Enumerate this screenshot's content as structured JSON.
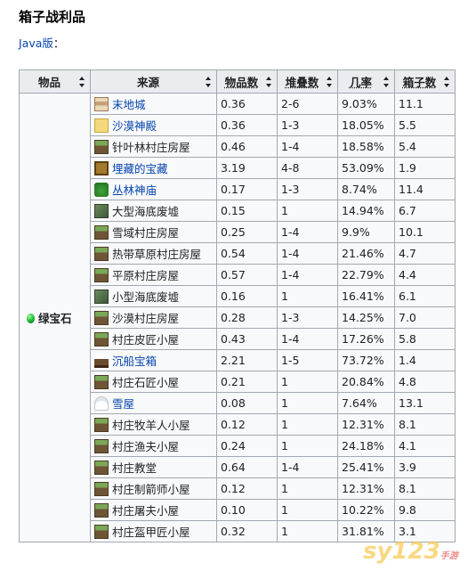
{
  "title": "箱子战利品",
  "edition": {
    "link": "Java版",
    "suffix": "："
  },
  "columns": [
    "物品",
    "来源",
    "物品数",
    "堆叠数",
    "几率",
    "箱子数"
  ],
  "item": {
    "name": "绿宝石",
    "icon": "emerald-icon"
  },
  "rows": [
    {
      "source": "末地城",
      "icon": "end-city-icon",
      "link": true,
      "count": "0.36",
      "stack": "2-6",
      "chance": "9.03%",
      "chests": "11.1"
    },
    {
      "source": "沙漠神殿",
      "icon": "desert-temple-icon",
      "link": true,
      "count": "0.36",
      "stack": "1-3",
      "chance": "18.05%",
      "chests": "5.5"
    },
    {
      "source": "针叶林村庄房屋",
      "icon": "village-house-icon",
      "link": false,
      "count": "0.46",
      "stack": "1-4",
      "chance": "18.58%",
      "chests": "5.4"
    },
    {
      "source": "埋藏的宝藏",
      "icon": "buried-treasure-icon",
      "link": true,
      "count": "3.19",
      "stack": "4-8",
      "chance": "53.09%",
      "chests": "1.9"
    },
    {
      "source": "丛林神庙",
      "icon": "jungle-temple-icon",
      "link": true,
      "count": "0.17",
      "stack": "1-3",
      "chance": "8.74%",
      "chests": "11.4"
    },
    {
      "source": "大型海底废墟",
      "icon": "ocean-ruin-icon",
      "link": false,
      "count": "0.15",
      "stack": "1",
      "chance": "14.94%",
      "chests": "6.7"
    },
    {
      "source": "雪域村庄房屋",
      "icon": "village-house-icon",
      "link": false,
      "count": "0.25",
      "stack": "1-4",
      "chance": "9.9%",
      "chests": "10.1"
    },
    {
      "source": "热带草原村庄房屋",
      "icon": "village-house-icon",
      "link": false,
      "count": "0.54",
      "stack": "1-4",
      "chance": "21.46%",
      "chests": "4.7"
    },
    {
      "source": "平原村庄房屋",
      "icon": "village-house-icon",
      "link": false,
      "count": "0.57",
      "stack": "1-4",
      "chance": "22.79%",
      "chests": "4.4"
    },
    {
      "source": "小型海底废墟",
      "icon": "ocean-ruin-icon",
      "link": false,
      "count": "0.16",
      "stack": "1",
      "chance": "16.41%",
      "chests": "6.1"
    },
    {
      "source": "沙漠村庄房屋",
      "icon": "village-house-icon",
      "link": false,
      "count": "0.28",
      "stack": "1-3",
      "chance": "14.25%",
      "chests": "7.0"
    },
    {
      "source": "村庄皮匠小屋",
      "icon": "village-house-icon",
      "link": false,
      "count": "0.43",
      "stack": "1-4",
      "chance": "17.26%",
      "chests": "5.8"
    },
    {
      "source": "沉船宝箱",
      "icon": "shipwreck-icon",
      "link": true,
      "count": "2.21",
      "stack": "1-5",
      "chance": "73.72%",
      "chests": "1.4"
    },
    {
      "source": "村庄石匠小屋",
      "icon": "village-house-icon",
      "link": false,
      "count": "0.21",
      "stack": "1",
      "chance": "20.84%",
      "chests": "4.8"
    },
    {
      "source": "雪屋",
      "icon": "igloo-icon",
      "link": true,
      "count": "0.08",
      "stack": "1",
      "chance": "7.64%",
      "chests": "13.1"
    },
    {
      "source": "村庄牧羊人小屋",
      "icon": "village-house-icon",
      "link": false,
      "count": "0.12",
      "stack": "1",
      "chance": "12.31%",
      "chests": "8.1"
    },
    {
      "source": "村庄渔夫小屋",
      "icon": "village-house-icon",
      "link": false,
      "count": "0.24",
      "stack": "1",
      "chance": "24.18%",
      "chests": "4.1"
    },
    {
      "source": "村庄教堂",
      "icon": "village-house-icon",
      "link": false,
      "count": "0.64",
      "stack": "1-4",
      "chance": "25.41%",
      "chests": "3.9"
    },
    {
      "source": "村庄制箭师小屋",
      "icon": "village-house-icon",
      "link": false,
      "count": "0.12",
      "stack": "1",
      "chance": "12.31%",
      "chests": "8.1"
    },
    {
      "source": "村庄屠夫小屋",
      "icon": "village-house-icon",
      "link": false,
      "count": "0.10",
      "stack": "1",
      "chance": "10.22%",
      "chests": "9.8"
    },
    {
      "source": "村庄盔甲匠小屋",
      "icon": "village-house-icon",
      "link": false,
      "count": "0.32",
      "stack": "1",
      "chance": "31.81%",
      "chests": "3.1"
    }
  ],
  "colors": {
    "link": "#0645ad",
    "header_bg": "#eaecf0",
    "border": "#a2a9b1"
  }
}
